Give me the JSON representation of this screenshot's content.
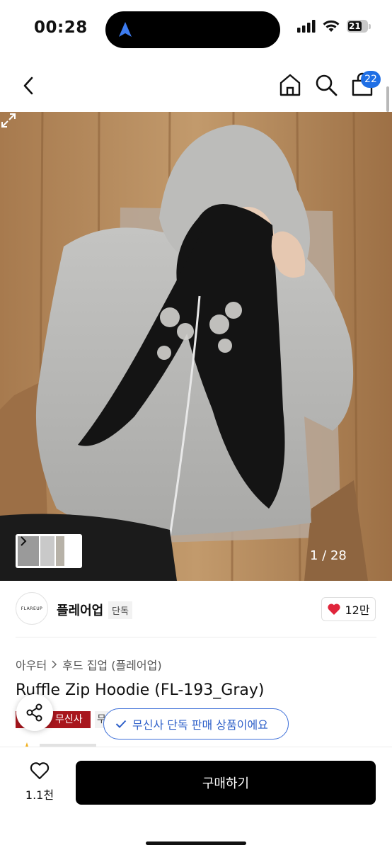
{
  "status": {
    "time": "00:28",
    "battery": "21",
    "icons": [
      "location-arrow-icon",
      "signal-icon",
      "wifi-icon",
      "battery-icon"
    ]
  },
  "nav": {
    "cart_count": "22",
    "icons": [
      "back-icon",
      "home-icon",
      "search-icon",
      "cart-icon"
    ]
  },
  "gallery": {
    "counter": "1 / 28"
  },
  "brand": {
    "logo_text": "FLAREUP",
    "name": "플레어업",
    "tag": "단독",
    "likes": "12만"
  },
  "product": {
    "breadcrumb": [
      "아우터",
      "후드 집업 (플레어업)"
    ],
    "title": "Ruffle Zip Hoodie (FL-193_Gray)",
    "badge": "무신사위크",
    "extra_badge": "무",
    "exclusive_notice": "무신사 단독 판매 상품이에요"
  },
  "bottom": {
    "wish_count": "1.1천",
    "buy_label": "구매하기"
  },
  "colors": {
    "accent_blue": "#1f6fe5",
    "badge_red": "#a8161d",
    "heart_red": "#e0253b"
  }
}
